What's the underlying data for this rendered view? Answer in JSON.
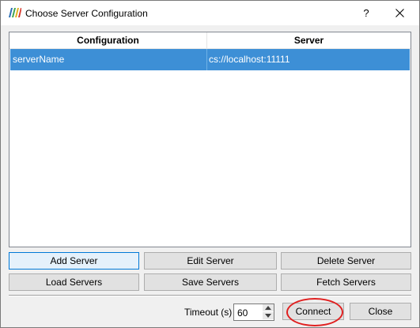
{
  "window": {
    "title": "Choose Server Configuration",
    "help_glyph": "?",
    "app_icon": "paraview-logo-icon",
    "close_icon": "close-icon"
  },
  "table": {
    "columns": [
      "Configuration",
      "Server"
    ],
    "rows": [
      {
        "configuration": "serverName",
        "server": "cs://localhost:11111",
        "selected": true
      }
    ]
  },
  "buttons": {
    "add_server": "Add Server",
    "edit_server": "Edit Server",
    "delete_server": "Delete Server",
    "load_servers": "Load Servers",
    "save_servers": "Save Servers",
    "fetch_servers": "Fetch Servers",
    "connect": "Connect",
    "close": "Close"
  },
  "timeout": {
    "label": "Timeout (s)",
    "value": "60"
  },
  "colors": {
    "selection": "#3d8fd6",
    "annotation_ring": "#e02020",
    "default_button_border": "#0078d7"
  }
}
